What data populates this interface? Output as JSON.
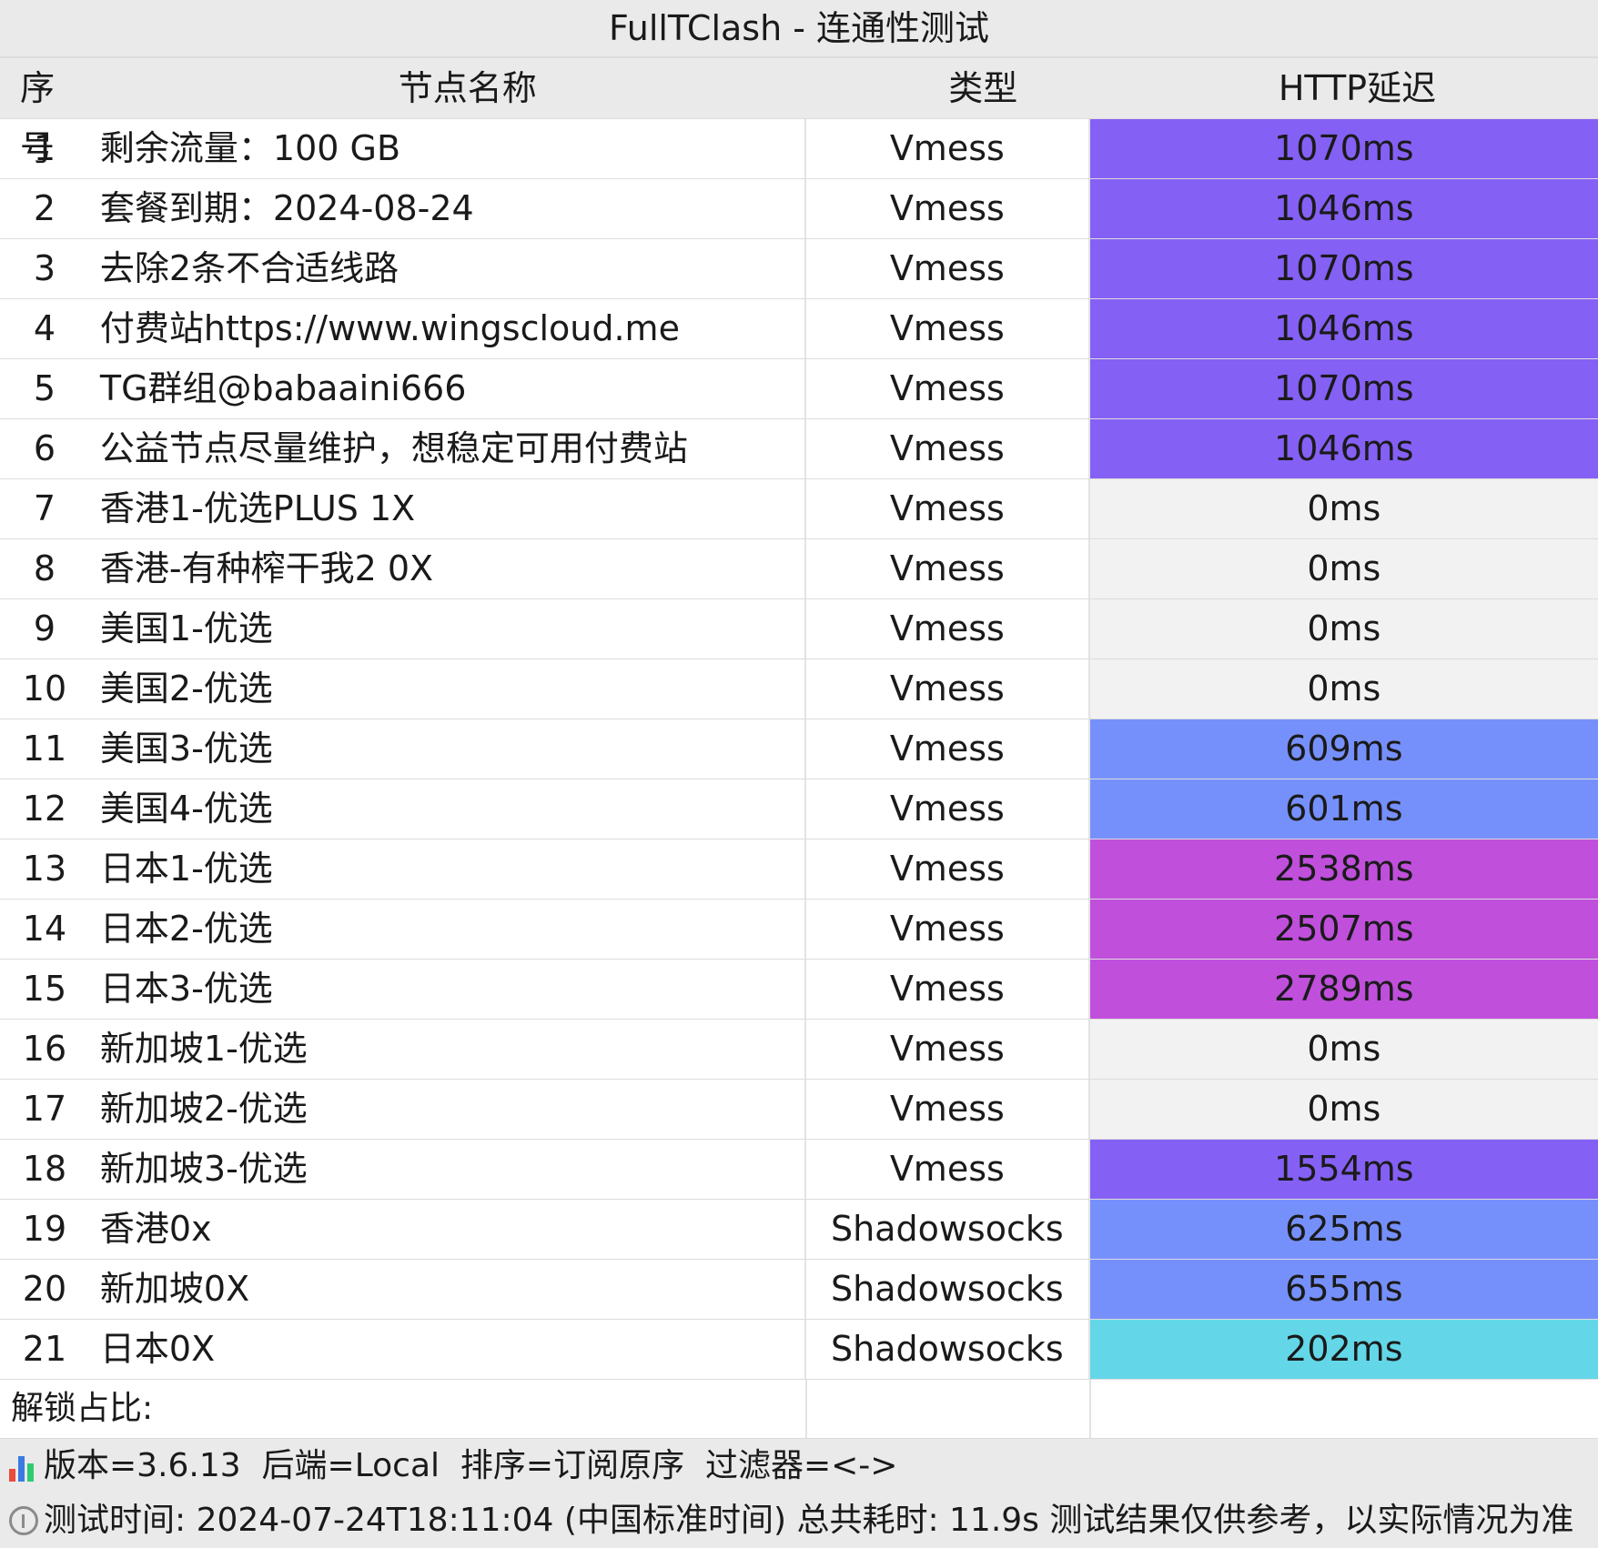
{
  "title": "FullTClash - 连通性测试",
  "columns": {
    "index": "序号",
    "name": "节点名称",
    "type": "类型",
    "latency": "HTTP延迟"
  },
  "rows": [
    {
      "index": "1",
      "name": "剩余流量：100 GB",
      "type": "Vmess",
      "latency": "1070ms",
      "color": "#8560f5"
    },
    {
      "index": "2",
      "name": "套餐到期：2024-08-24",
      "type": "Vmess",
      "latency": "1046ms",
      "color": "#8560f5"
    },
    {
      "index": "3",
      "name": "去除2条不合适线路",
      "type": "Vmess",
      "latency": "1070ms",
      "color": "#8560f5"
    },
    {
      "index": "4",
      "name": "付费站https://www.wingscloud.me",
      "type": "Vmess",
      "latency": "1046ms",
      "color": "#8560f5"
    },
    {
      "index": "5",
      "name": "TG群组@babaaini666",
      "type": "Vmess",
      "latency": "1070ms",
      "color": "#8560f5"
    },
    {
      "index": "6",
      "name": "公益节点尽量维护，想稳定可用付费站",
      "type": "Vmess",
      "latency": "1046ms",
      "color": "#8560f5"
    },
    {
      "index": "7",
      "name": "香港1-优选PLUS 1X",
      "type": "Vmess",
      "latency": "0ms",
      "color": "#f2f2f2"
    },
    {
      "index": "8",
      "name": "香港-有种榨干我2 0X",
      "type": "Vmess",
      "latency": "0ms",
      "color": "#f2f2f2"
    },
    {
      "index": "9",
      "name": "美国1-优选",
      "type": "Vmess",
      "latency": "0ms",
      "color": "#f2f2f2"
    },
    {
      "index": "10",
      "name": "美国2-优选",
      "type": "Vmess",
      "latency": "0ms",
      "color": "#f2f2f2"
    },
    {
      "index": "11",
      "name": "美国3-优选",
      "type": "Vmess",
      "latency": "609ms",
      "color": "#7690fb"
    },
    {
      "index": "12",
      "name": "美国4-优选",
      "type": "Vmess",
      "latency": "601ms",
      "color": "#7690fb"
    },
    {
      "index": "13",
      "name": "日本1-优选",
      "type": "Vmess",
      "latency": "2538ms",
      "color": "#c04fdc"
    },
    {
      "index": "14",
      "name": "日本2-优选",
      "type": "Vmess",
      "latency": "2507ms",
      "color": "#c04fdc"
    },
    {
      "index": "15",
      "name": "日本3-优选",
      "type": "Vmess",
      "latency": "2789ms",
      "color": "#c04fdc"
    },
    {
      "index": "16",
      "name": "新加坡1-优选",
      "type": "Vmess",
      "latency": "0ms",
      "color": "#f2f2f2"
    },
    {
      "index": "17",
      "name": "新加坡2-优选",
      "type": "Vmess",
      "latency": "0ms",
      "color": "#f2f2f2"
    },
    {
      "index": "18",
      "name": "新加坡3-优选",
      "type": "Vmess",
      "latency": "1554ms",
      "color": "#8560f5"
    },
    {
      "index": "19",
      "name": "香港0x",
      "type": "Shadowsocks",
      "latency": "625ms",
      "color": "#7690fb"
    },
    {
      "index": "20",
      "name": "新加坡0X",
      "type": "Shadowsocks",
      "latency": "655ms",
      "color": "#7690fb"
    },
    {
      "index": "21",
      "name": "日本0X",
      "type": "Shadowsocks",
      "latency": "202ms",
      "color": "#63d7e8"
    }
  ],
  "unlock_label": "解锁占比:",
  "footer": {
    "version_line": "版本=3.6.13  后端=Local  排序=订阅原序  过滤器=<->",
    "time_line": "测试时间: 2024-07-24T18:11:04 (中国标准时间) 总共耗时: 11.9s 测试结果仅供参考，以实际情况为准"
  },
  "icons": {
    "version": "bar-chart-icon",
    "time": "info-icon"
  }
}
